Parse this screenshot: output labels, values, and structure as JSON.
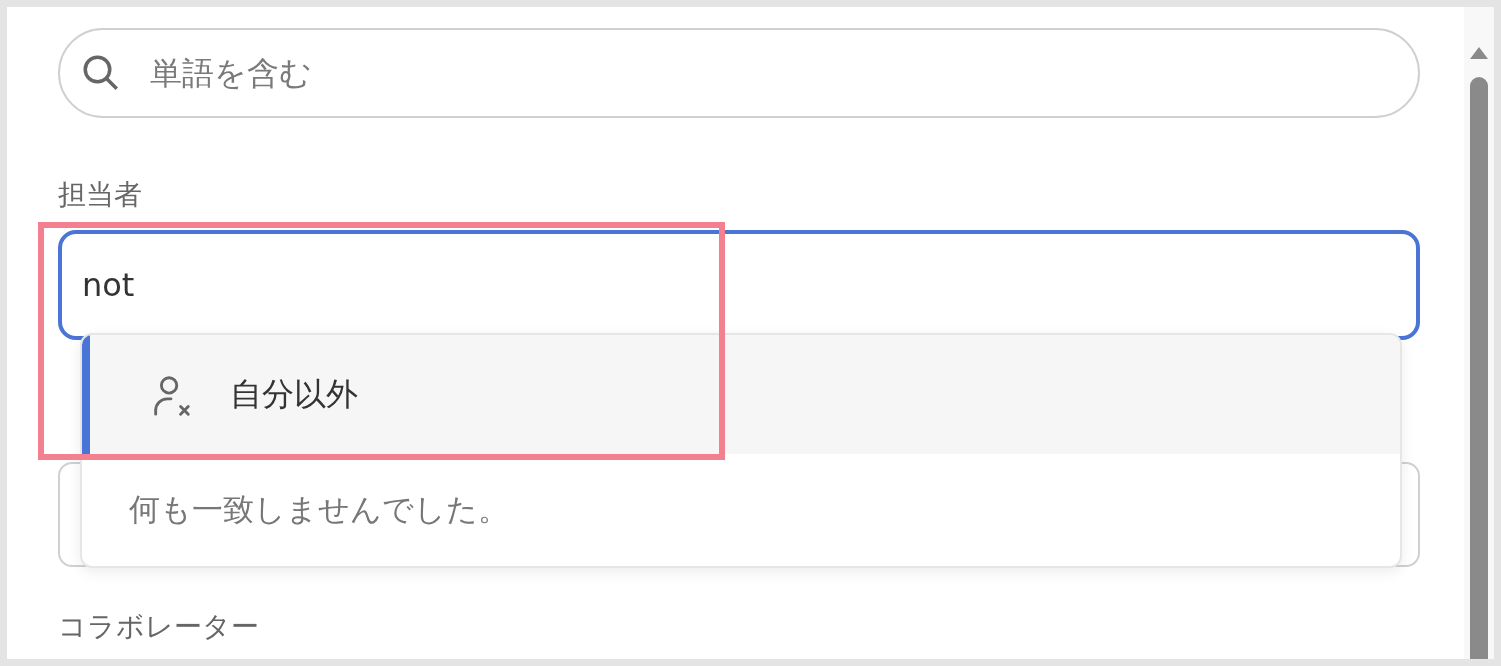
{
  "search": {
    "placeholder": "単語を含む"
  },
  "assignee": {
    "label": "担当者",
    "value": "not",
    "focused": true
  },
  "dropdown": {
    "options": [
      {
        "label": "自分以外",
        "selected": true
      }
    ],
    "empty_message": "何も一致しませんでした。"
  },
  "next_label": "コラボレーター"
}
